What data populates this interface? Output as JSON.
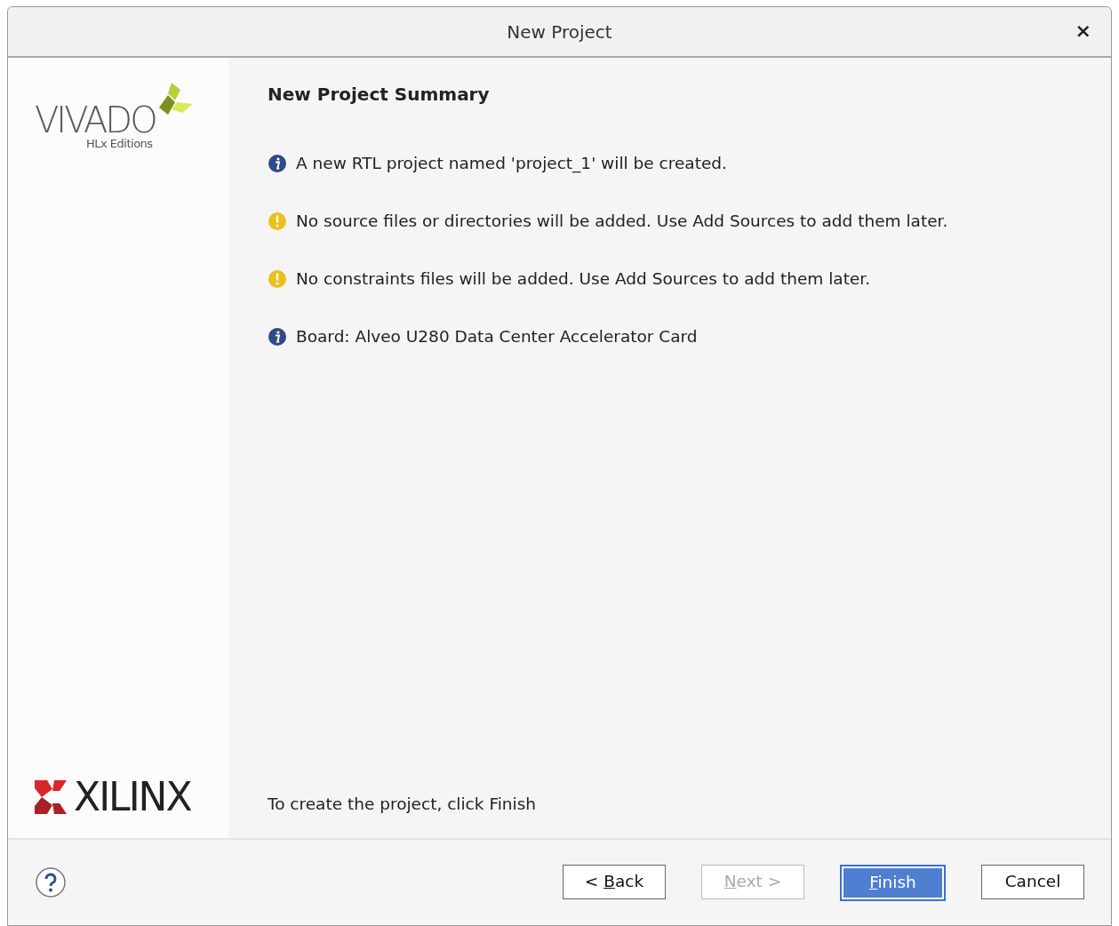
{
  "window": {
    "title": "New Project",
    "close": "×"
  },
  "sidebar": {
    "product": "VIVADO",
    "edition": "HLx Editions",
    "vendor": "XILINX"
  },
  "page": {
    "heading": "New Project Summary",
    "messages": [
      {
        "kind": "info",
        "text": "A new RTL project named 'project_1' will be created."
      },
      {
        "kind": "warning",
        "text": "No source files or directories will be added. Use Add Sources to add them later."
      },
      {
        "kind": "warning",
        "text": "No constraints files will be added. Use Add Sources to add them later."
      },
      {
        "kind": "info",
        "text": "Board: Alveo U280 Data Center Accelerator Card"
      }
    ],
    "footer_note": "To create the project, click Finish"
  },
  "buttons": [
    {
      "prefix": "< ",
      "key": "B",
      "rest": "ack",
      "disabled": false,
      "default": false
    },
    {
      "key": "N",
      "rest": "ext >",
      "disabled": true,
      "default": false
    },
    {
      "key": "F",
      "rest": "inish",
      "disabled": false,
      "default": true
    },
    {
      "rest": "Cancel",
      "disabled": false,
      "default": false
    }
  ]
}
